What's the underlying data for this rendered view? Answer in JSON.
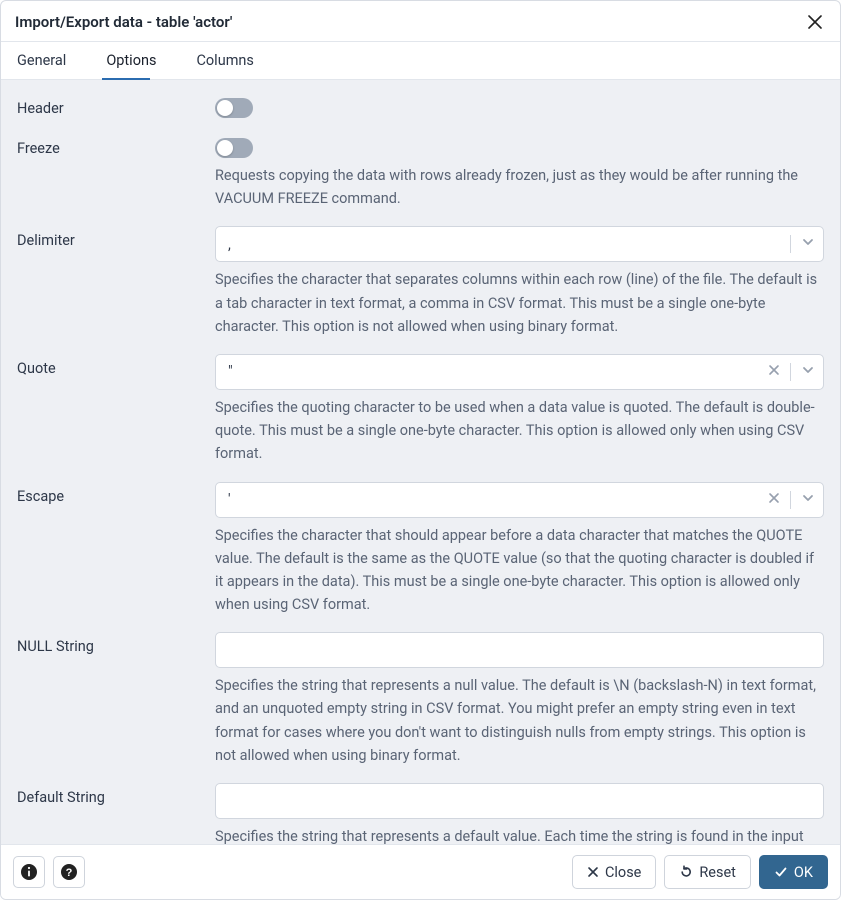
{
  "dialog": {
    "title": "Import/Export data - table 'actor'"
  },
  "tabs": {
    "general": "General",
    "options": "Options",
    "columns": "Columns",
    "active": "options"
  },
  "fields": {
    "header": {
      "label": "Header"
    },
    "freeze": {
      "label": "Freeze",
      "help": "Requests copying the data with rows already frozen, just as they would be after running the VACUUM FREEZE command."
    },
    "delimiter": {
      "label": "Delimiter",
      "value": ",",
      "help": "Specifies the character that separates columns within each row (line) of the file. The default is a tab character in text format, a comma in CSV format. This must be a single one-byte character. This option is not allowed when using binary format."
    },
    "quote": {
      "label": "Quote",
      "value": "\"",
      "help": "Specifies the quoting character to be used when a data value is quoted. The default is double-quote. This must be a single one-byte character. This option is allowed only when using CSV format."
    },
    "escape": {
      "label": "Escape",
      "value": "'",
      "help": "Specifies the character that should appear before a data character that matches the QUOTE value. The default is the same as the QUOTE value (so that the quoting character is doubled if it appears in the data). This must be a single one-byte character. This option is allowed only when using CSV format."
    },
    "null_string": {
      "label": "NULL String",
      "value": "",
      "help": "Specifies the string that represents a null value. The default is \\N (backslash-N) in text format, and an unquoted empty string in CSV format. You might prefer an empty string even in text format for cases where you don't want to distinguish nulls from empty strings. This option is not allowed when using binary format."
    },
    "default_string": {
      "label": "Default String",
      "value": "",
      "help": "Specifies the string that represents a default value. Each time the string is found in the input file, the default value of the corresponding column will be used. This option is allowed only in COPY FROM, and only when not using binary format"
    }
  },
  "footer": {
    "close": "Close",
    "reset": "Reset",
    "ok": "OK"
  }
}
